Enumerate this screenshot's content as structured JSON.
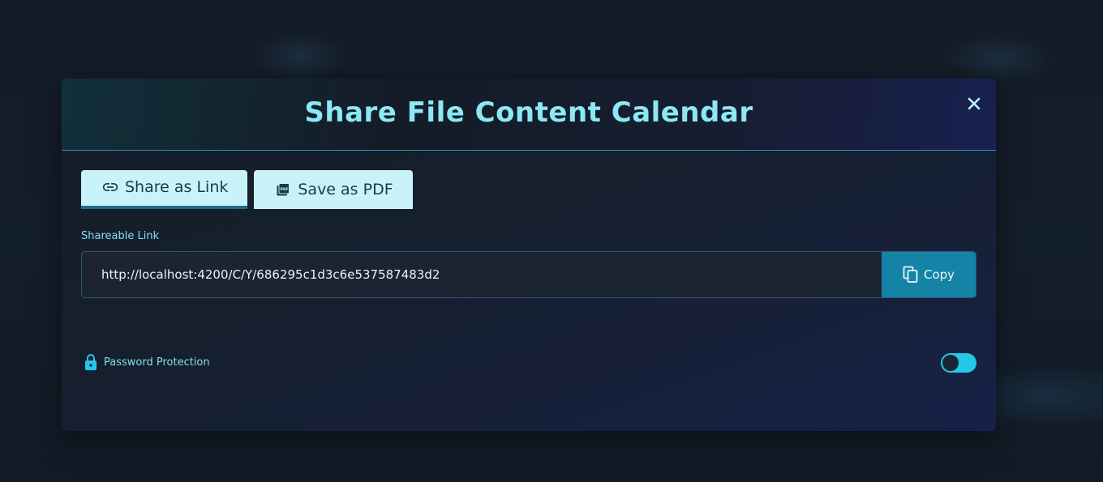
{
  "modal": {
    "title": "Share File Content Calendar",
    "close_icon": "close-icon"
  },
  "tabs": [
    {
      "label": "Share as Link",
      "icon": "link-icon",
      "active": true
    },
    {
      "label": "Save as PDF",
      "icon": "pdf-icon",
      "active": false
    }
  ],
  "link_section": {
    "label": "Shareable Link",
    "value": "http://localhost:4200/C/Y/686295c1d3c6e537587483d2",
    "copy_label": "Copy",
    "copy_icon": "copy-icon"
  },
  "password": {
    "label": "Password Protection",
    "icon": "lock-icon",
    "enabled": false
  },
  "colors": {
    "accent": "#8ce8f5",
    "tab_bg": "#c9f3f8",
    "copy_button": "#1483a6",
    "toggle_track": "#22c8e8"
  }
}
